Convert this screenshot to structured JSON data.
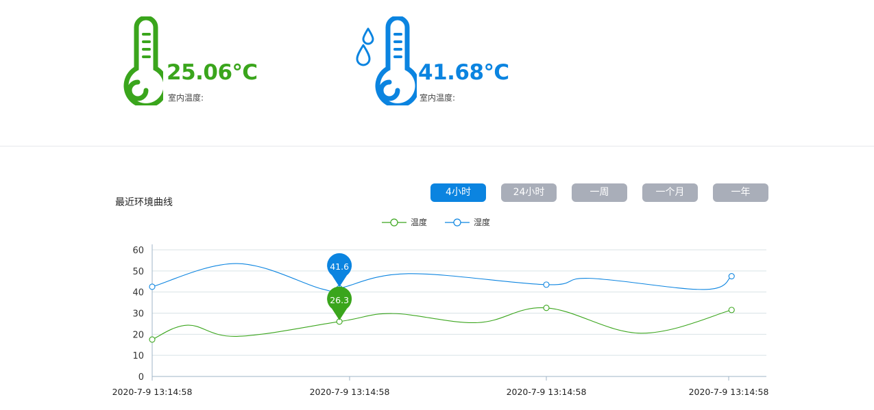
{
  "cards": {
    "temperature": {
      "value": "25.06℃",
      "label": "室内温度:",
      "color": "#3aa51c"
    },
    "humidity": {
      "value": "41.68℃",
      "label": "室内温度:",
      "color": "#0b84e0"
    }
  },
  "section_title": "最近环境曲线",
  "ranges": [
    {
      "label": "4小时",
      "active": true
    },
    {
      "label": "24小时",
      "active": false
    },
    {
      "label": "一周",
      "active": false
    },
    {
      "label": "一个月",
      "active": false
    },
    {
      "label": "一年",
      "active": false
    }
  ],
  "legend": [
    {
      "name": "温度",
      "color": "#3aa51c"
    },
    {
      "name": "湿度",
      "color": "#0b84e0"
    }
  ],
  "chart_data": {
    "type": "line",
    "x": [
      "2020-7-9  13:14:58",
      "2020-7-9  13:14:58",
      "2020-7-9  13:14:58",
      "2020-7-9  13:14:58"
    ],
    "ylim": [
      0,
      60
    ],
    "yticks": [
      0,
      10,
      20,
      30,
      40,
      50,
      60
    ],
    "grid": true,
    "series": [
      {
        "name": "温度",
        "color": "#3aa51c",
        "points": [
          {
            "x": 0.0,
            "y": 17.5,
            "marker": true
          },
          {
            "x": 0.18,
            "y": 24.3
          },
          {
            "x": 0.43,
            "y": 19.0
          },
          {
            "x": 0.95,
            "y": 26.0,
            "marker": true
          },
          {
            "x": 1.22,
            "y": 29.8
          },
          {
            "x": 1.65,
            "y": 25.5
          },
          {
            "x": 2.0,
            "y": 32.5,
            "marker": true
          },
          {
            "x": 2.48,
            "y": 20.5
          },
          {
            "x": 2.94,
            "y": 31.5,
            "marker": true
          }
        ],
        "tooltip": {
          "x": 0.95,
          "label": "26.3"
        }
      },
      {
        "name": "湿度",
        "color": "#0b84e0",
        "points": [
          {
            "x": 0.0,
            "y": 42.5,
            "marker": true
          },
          {
            "x": 0.43,
            "y": 53.5
          },
          {
            "x": 0.86,
            "y": 41.5
          },
          {
            "x": 0.95,
            "y": 41.8,
            "marker": true
          },
          {
            "x": 1.3,
            "y": 48.7
          },
          {
            "x": 2.0,
            "y": 43.5,
            "marker": true
          },
          {
            "x": 2.22,
            "y": 46.5
          },
          {
            "x": 2.8,
            "y": 41.2
          },
          {
            "x": 2.94,
            "y": 47.5,
            "marker": true
          }
        ],
        "tooltip": {
          "x": 0.95,
          "label": "41.6"
        }
      }
    ]
  }
}
